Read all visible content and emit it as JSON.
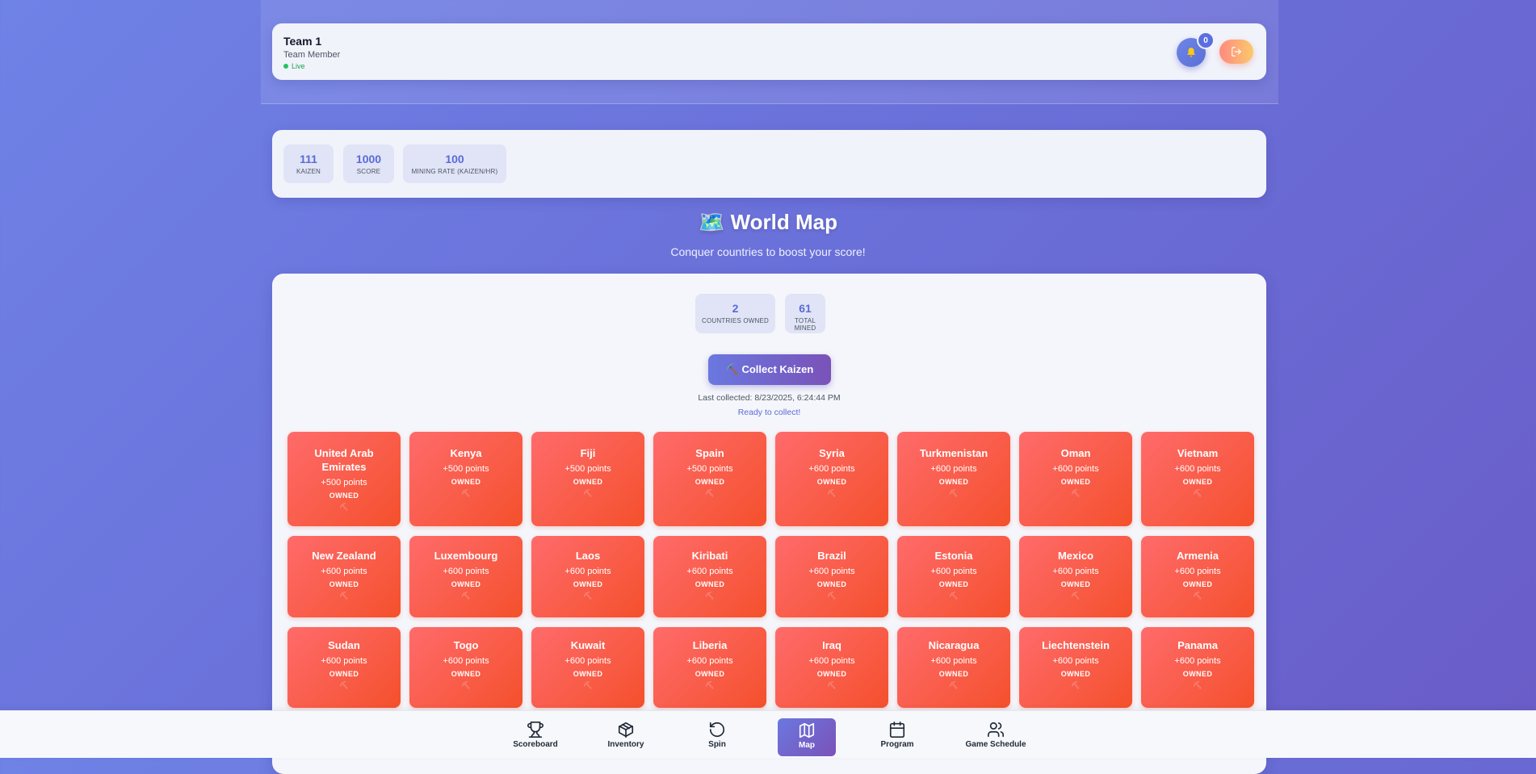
{
  "header": {
    "team_name": "Team 1",
    "role": "Team Member",
    "status": "Live",
    "notification_count": "0",
    "notification_icon": "bell-icon",
    "logout_icon": "logout-icon"
  },
  "stats": [
    {
      "value": "111",
      "label": "KAIZEN"
    },
    {
      "value": "1000",
      "label": "SCORE"
    },
    {
      "value": "100",
      "label": "MINING RATE (KAIZEN/HR)"
    }
  ],
  "page": {
    "title": "🗺️ World Map",
    "subtitle": "Conquer countries to boost your score!"
  },
  "map": {
    "stats": [
      {
        "value": "2",
        "label": "COUNTRIES OWNED"
      },
      {
        "value": "61",
        "label": "TOTAL MINED"
      }
    ],
    "collect_label": "⛏️ Collect Kaizen",
    "last_collected": "Last collected: 8/23/2025, 6:24:44 PM",
    "ready": "Ready to collect!",
    "countries": [
      {
        "name": "United Arab Emirates",
        "points": "+500 points",
        "status": "OWNED"
      },
      {
        "name": "Kenya",
        "points": "+500 points",
        "status": "OWNED"
      },
      {
        "name": "Fiji",
        "points": "+500 points",
        "status": "OWNED"
      },
      {
        "name": "Spain",
        "points": "+500 points",
        "status": "OWNED"
      },
      {
        "name": "Syria",
        "points": "+600 points",
        "status": "OWNED"
      },
      {
        "name": "Turkmenistan",
        "points": "+600 points",
        "status": "OWNED"
      },
      {
        "name": "Oman",
        "points": "+600 points",
        "status": "OWNED"
      },
      {
        "name": "Vietnam",
        "points": "+600 points",
        "status": "OWNED"
      },
      {
        "name": "New Zealand",
        "points": "+600 points",
        "status": "OWNED"
      },
      {
        "name": "Luxembourg",
        "points": "+600 points",
        "status": "OWNED"
      },
      {
        "name": "Laos",
        "points": "+600 points",
        "status": "OWNED"
      },
      {
        "name": "Kiribati",
        "points": "+600 points",
        "status": "OWNED"
      },
      {
        "name": "Brazil",
        "points": "+600 points",
        "status": "OWNED"
      },
      {
        "name": "Estonia",
        "points": "+600 points",
        "status": "OWNED"
      },
      {
        "name": "Mexico",
        "points": "+600 points",
        "status": "OWNED"
      },
      {
        "name": "Armenia",
        "points": "+600 points",
        "status": "OWNED"
      },
      {
        "name": "Sudan",
        "points": "+600 points",
        "status": "OWNED"
      },
      {
        "name": "Togo",
        "points": "+600 points",
        "status": "OWNED"
      },
      {
        "name": "Kuwait",
        "points": "+600 points",
        "status": "OWNED"
      },
      {
        "name": "Liberia",
        "points": "+600 points",
        "status": "OWNED"
      },
      {
        "name": "Iraq",
        "points": "+600 points",
        "status": "OWNED"
      },
      {
        "name": "Nicaragua",
        "points": "+600 points",
        "status": "OWNED"
      },
      {
        "name": "Liechtenstein",
        "points": "+600 points",
        "status": "OWNED"
      },
      {
        "name": "Panama",
        "points": "+600 points",
        "status": "OWNED"
      }
    ]
  },
  "nav": [
    {
      "label": "Scoreboard",
      "icon": "trophy-icon",
      "active": false
    },
    {
      "label": "Inventory",
      "icon": "box-icon",
      "active": false
    },
    {
      "label": "Spin",
      "icon": "rotate-icon",
      "active": false
    },
    {
      "label": "Map",
      "icon": "map-icon",
      "active": true
    },
    {
      "label": "Program",
      "icon": "calendar-icon",
      "active": false
    },
    {
      "label": "Game Schedule",
      "icon": "users-icon",
      "active": false
    }
  ],
  "colors": {
    "accent": "#5b6bd6",
    "country_card": "#f4502c",
    "live": "#22c55e"
  }
}
